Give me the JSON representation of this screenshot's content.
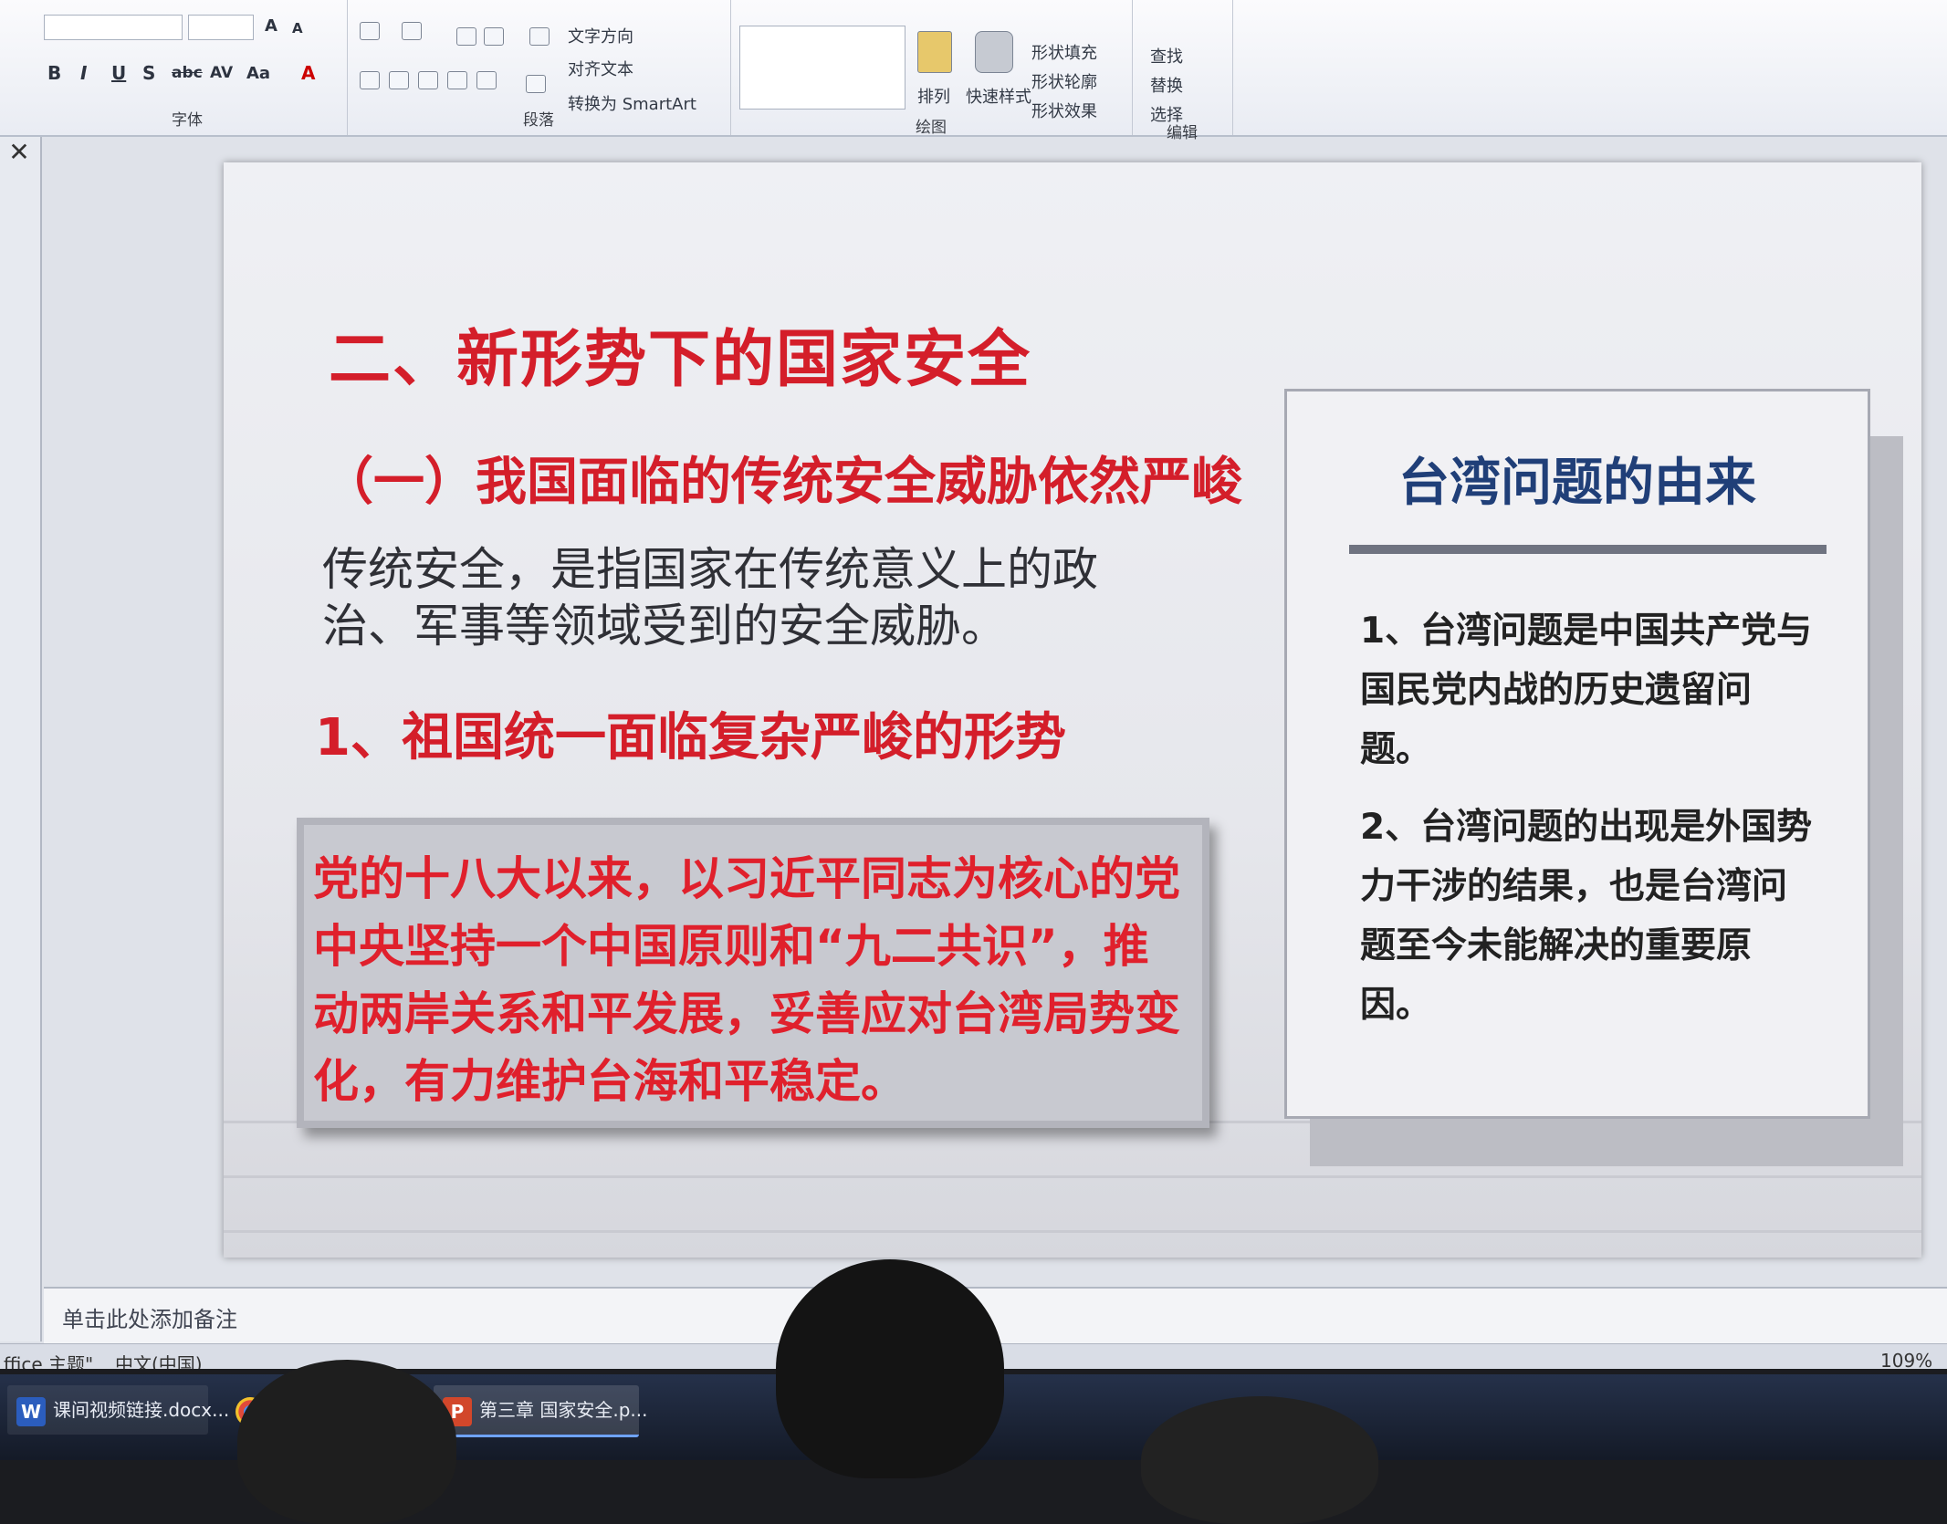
{
  "ribbon": {
    "font_group_label": "字体",
    "paragraph_group_label": "段落",
    "drawing_group_label": "绘图",
    "editing_group_label": "编辑",
    "text_direction": "文字方向",
    "align_text": "对齐文本",
    "convert_smartart": "转换为 SmartArt",
    "arrange": "排列",
    "quick_styles": "快速样式",
    "shape_fill": "形状填充",
    "shape_outline": "形状轮廓",
    "shape_effects": "形状效果",
    "find": "查找",
    "replace": "替换",
    "select": "选择",
    "bold": "B",
    "italic": "I",
    "underline": "U",
    "strike": "S",
    "abc": "abc",
    "av": "AV",
    "aa": "Aa",
    "font_color": "A",
    "grow": "A",
    "shrink": "A"
  },
  "slide": {
    "title": "二、新形势下的国家安全",
    "subtitle": "（一）我国面临的传统安全威胁依然严峻",
    "definition": "传统安全，是指国家在传统意义上的政治、军事等领域受到的安全威胁。",
    "point1": "1、祖国统一面临复杂严峻的形势",
    "highlight_text": "党的十八大以来，以习近平同志为核心的党中央坚持一个中国原则和“九二共识”，推动两岸关系和平发展，妥善应对台湾局势变化，有力维护台海和平稳定。",
    "card": {
      "title": "台湾问题的由来",
      "items": [
        "1、台湾问题是中国共产党与国民党内战的历史遗留问题。",
        "2、台湾问题的出现是外国势力干涉的结果，也是台湾问题至今未能解决的重要原因。"
      ]
    }
  },
  "notes_placeholder": "单击此处添加备注",
  "status": {
    "theme": "ffice 主题\"",
    "language": "中文(中国)",
    "zoom": "109%"
  },
  "taskbar": {
    "items": [
      {
        "label": "课间视频链接.docx..."
      },
      {
        "label": "第三章  国家安全.p..."
      }
    ]
  },
  "colors": {
    "title_red": "#d41e2a",
    "card_title_blue": "#203f78",
    "taskbar": "#1c2436"
  }
}
